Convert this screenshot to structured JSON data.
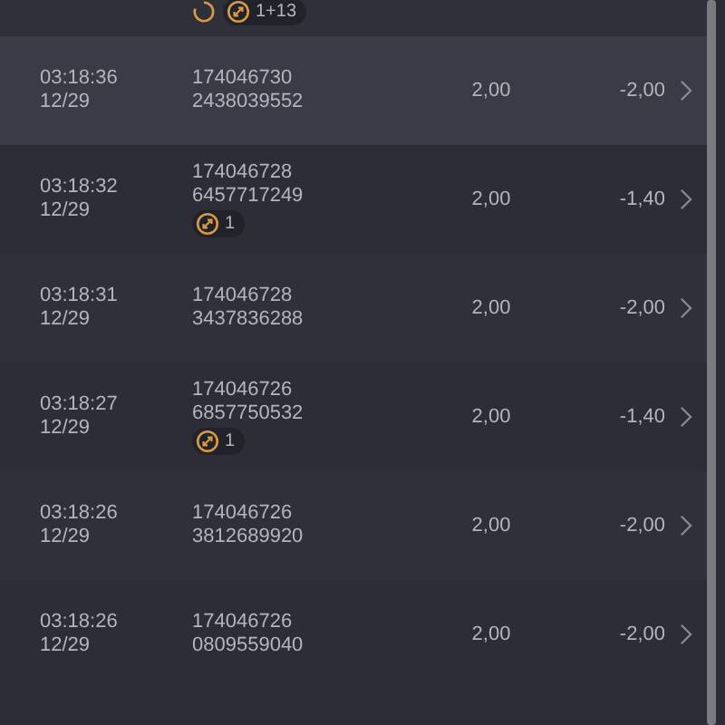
{
  "partial_row": {
    "pending": true,
    "badge": "1+13"
  },
  "rows": [
    {
      "time": "03:18:36",
      "date": "12/29",
      "id": "174046730",
      "ticket": "2438039552",
      "stake": "2,00",
      "result": "-2,00",
      "selected": true
    },
    {
      "time": "03:18:32",
      "date": "12/29",
      "id": "174046728",
      "ticket": "6457717249",
      "badge": "1",
      "stake": "2,00",
      "result": "-1,40",
      "selected": false
    },
    {
      "time": "03:18:31",
      "date": "12/29",
      "id": "174046728",
      "ticket": "3437836288",
      "stake": "2,00",
      "result": "-2,00",
      "selected": false
    },
    {
      "time": "03:18:27",
      "date": "12/29",
      "id": "174046726",
      "ticket": "6857750532",
      "badge": "1",
      "stake": "2,00",
      "result": "-1,40",
      "selected": false
    },
    {
      "time": "03:18:26",
      "date": "12/29",
      "id": "174046726",
      "ticket": "3812689920",
      "stake": "2,00",
      "result": "-2,00",
      "selected": false
    },
    {
      "time": "03:18:26",
      "date": "12/29",
      "id": "174046726",
      "ticket": "0809559040",
      "stake": "2,00",
      "result": "-2,00",
      "selected": false
    }
  ]
}
